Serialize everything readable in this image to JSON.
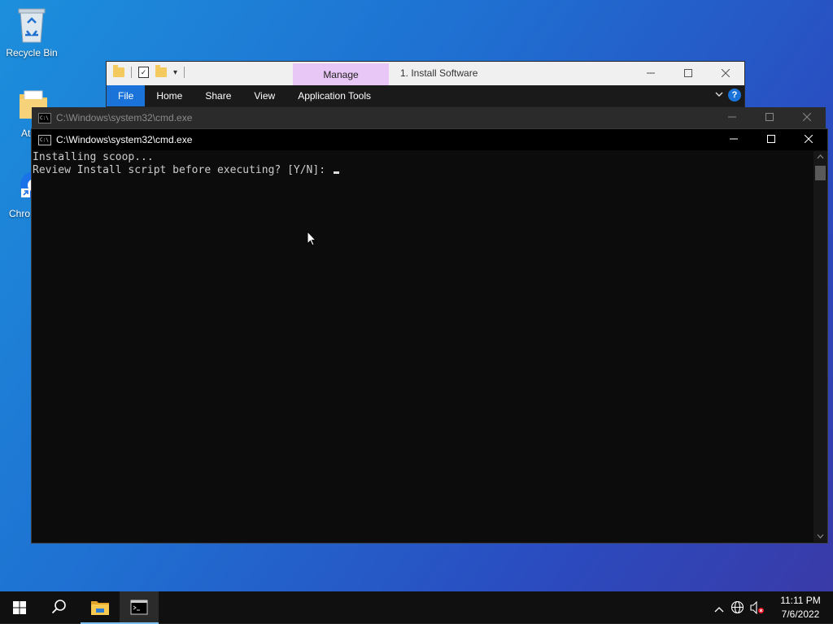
{
  "desktop": {
    "icons": [
      {
        "label": "Recycle Bin"
      },
      {
        "label": "At"
      },
      {
        "label": "Chro"
      }
    ]
  },
  "explorer": {
    "manage_tab": "Manage",
    "title": "1. Install Software",
    "ribbon_tabs": [
      "File",
      "Home",
      "Share",
      "View",
      "Application Tools"
    ],
    "help": "?"
  },
  "cmd_back": {
    "title": "C:\\Windows\\system32\\cmd.exe"
  },
  "cmd_front": {
    "title": "C:\\Windows\\system32\\cmd.exe",
    "lines": [
      "Installing scoop...",
      "Review Install script before executing? [Y/N]: "
    ]
  },
  "taskbar": {
    "time": "11:11 PM",
    "date": "7/6/2022"
  },
  "colors": {
    "explorer_manage_tab": "#e8c6f5",
    "accent": "#1a73d9",
    "console_bg": "#0c0c0c",
    "console_text": "#cccccc"
  }
}
